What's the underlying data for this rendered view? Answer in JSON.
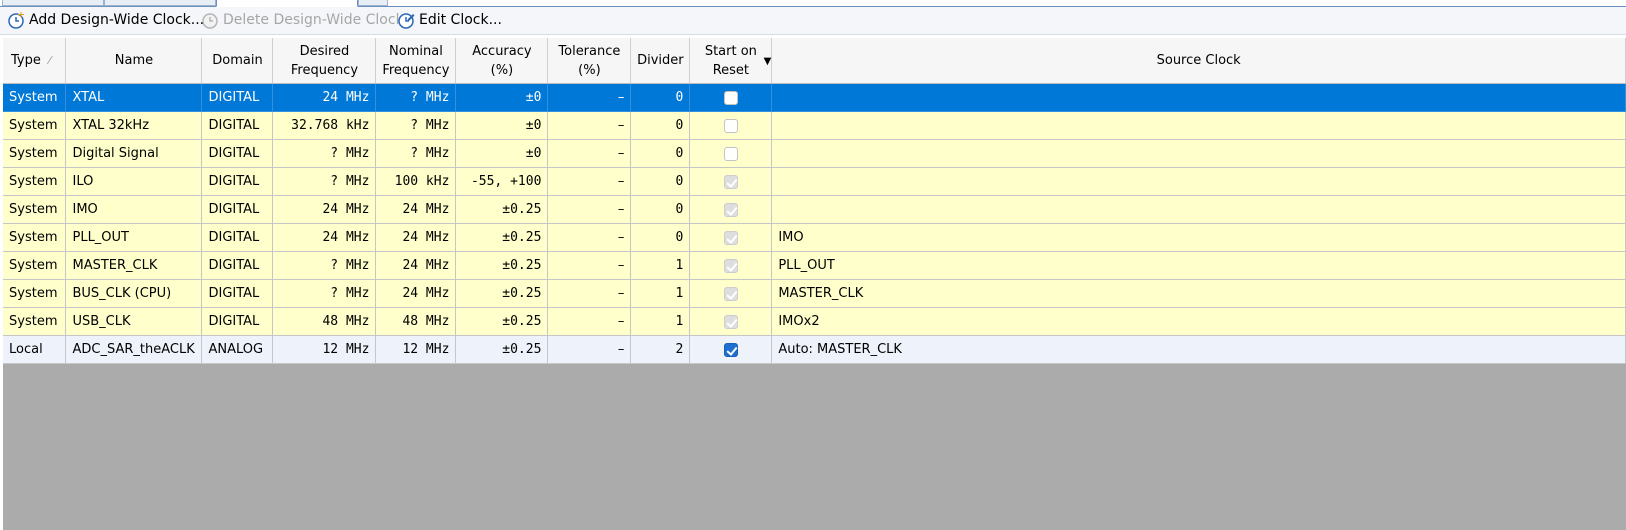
{
  "toolbar": {
    "add_label": "Add Design-Wide Clock...",
    "delete_label": "Delete Design-Wide Clock",
    "edit_label": "Edit Clock..."
  },
  "columns": {
    "type": "Type",
    "name": "Name",
    "domain": "Domain",
    "desired_l1": "Desired",
    "desired_l2": "Frequency",
    "nominal_l1": "Nominal",
    "nominal_l2": "Frequency",
    "accuracy_l1": "Accuracy",
    "accuracy_l2": "(%)",
    "tolerance_l1": "Tolerance",
    "tolerance_l2": "(%)",
    "divider": "Divider",
    "start_l1": "Start on",
    "start_l2": "Reset",
    "source": "Source Clock"
  },
  "rows": [
    {
      "type": "System",
      "name": "XTAL",
      "domain": "DIGITAL",
      "desired": "24 MHz",
      "nominal": "? MHz",
      "accuracy": "±0",
      "tolerance": "–",
      "divider": "0",
      "start": "unchecked",
      "source": ""
    },
    {
      "type": "System",
      "name": "XTAL 32kHz",
      "domain": "DIGITAL",
      "desired": "32.768 kHz",
      "nominal": "? MHz",
      "accuracy": "±0",
      "tolerance": "–",
      "divider": "0",
      "start": "unchecked",
      "source": ""
    },
    {
      "type": "System",
      "name": "Digital Signal",
      "domain": "DIGITAL",
      "desired": "? MHz",
      "nominal": "? MHz",
      "accuracy": "±0",
      "tolerance": "–",
      "divider": "0",
      "start": "unchecked",
      "source": ""
    },
    {
      "type": "System",
      "name": "ILO",
      "domain": "DIGITAL",
      "desired": "? MHz",
      "nominal": "100 kHz",
      "accuracy": "-55, +100",
      "tolerance": "–",
      "divider": "0",
      "start": "disabled-checked",
      "source": ""
    },
    {
      "type": "System",
      "name": "IMO",
      "domain": "DIGITAL",
      "desired": "24 MHz",
      "nominal": "24 MHz",
      "accuracy": "±0.25",
      "tolerance": "–",
      "divider": "0",
      "start": "disabled-checked",
      "source": ""
    },
    {
      "type": "System",
      "name": "PLL_OUT",
      "domain": "DIGITAL",
      "desired": "24 MHz",
      "nominal": "24 MHz",
      "accuracy": "±0.25",
      "tolerance": "–",
      "divider": "0",
      "start": "disabled-checked",
      "source": "IMO"
    },
    {
      "type": "System",
      "name": "MASTER_CLK",
      "domain": "DIGITAL",
      "desired": "? MHz",
      "nominal": "24 MHz",
      "accuracy": "±0.25",
      "tolerance": "–",
      "divider": "1",
      "start": "disabled-checked",
      "source": "PLL_OUT"
    },
    {
      "type": "System",
      "name": "BUS_CLK (CPU)",
      "domain": "DIGITAL",
      "desired": "? MHz",
      "nominal": "24 MHz",
      "accuracy": "±0.25",
      "tolerance": "–",
      "divider": "1",
      "start": "disabled-checked",
      "source": "MASTER_CLK"
    },
    {
      "type": "System",
      "name": "USB_CLK",
      "domain": "DIGITAL",
      "desired": "48 MHz",
      "nominal": "48 MHz",
      "accuracy": "±0.25",
      "tolerance": "–",
      "divider": "1",
      "start": "disabled-checked",
      "source": "IMOx2"
    },
    {
      "type": "Local",
      "name": "ADC_SAR_theACLK",
      "domain": "ANALOG",
      "desired": "12 MHz",
      "nominal": "12 MHz",
      "accuracy": "±0.25",
      "tolerance": "–",
      "divider": "2",
      "start": "checked",
      "source": "Auto: MASTER_CLK"
    }
  ],
  "colors": {
    "selected_row": "#0078d7",
    "system_row": "#ffffcc",
    "local_row": "#eef2fa",
    "empty_area": "#ababab"
  }
}
